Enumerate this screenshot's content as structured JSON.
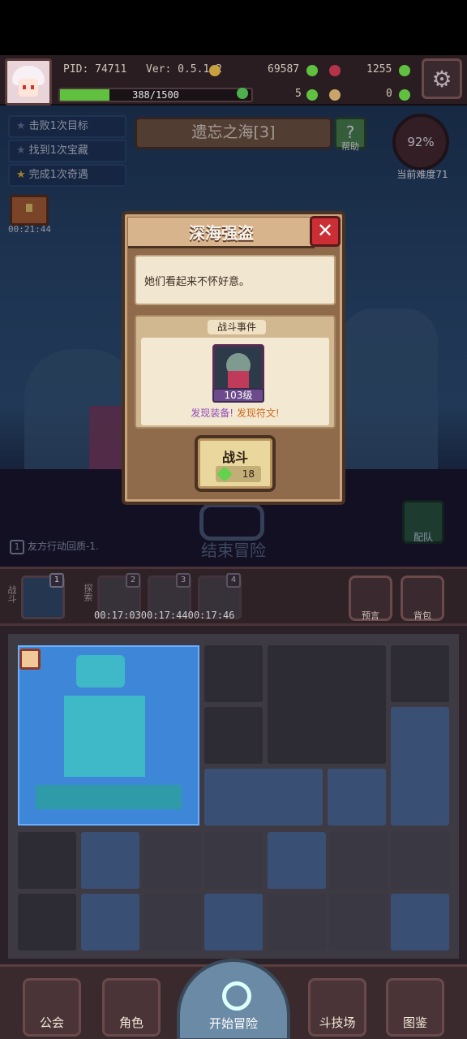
{
  "hud": {
    "pid": "PID: 74711",
    "version": "Ver: 0.5.1.2",
    "gold": "69587",
    "gems": "1255",
    "clover": "5",
    "potion": "0",
    "xp_text": "388/1500",
    "xp_fraction": 0.259
  },
  "location": {
    "name": "遗忘之海[3]",
    "help_label": "帮助",
    "difficulty_percent": "92%",
    "difficulty_label": "当前难度71"
  },
  "tasks": [
    {
      "label": "击败1次目标",
      "done": false
    },
    {
      "label": "找到1次宝藏",
      "done": false
    },
    {
      "label": "完成1次奇遇",
      "done": true
    }
  ],
  "chest_timer": "00:21:44",
  "modal": {
    "title": "深海强盗",
    "close_icon": "close-icon",
    "description": "她们看起来不怀好意。",
    "event_title": "战斗事件",
    "enemy_level": "103级",
    "find_equipment": "发现装备!",
    "find_rune": "发现符文!",
    "fight_label": "战斗",
    "fight_cost": "18"
  },
  "scene": {
    "end_adventure": "结束冒险",
    "team_label": "配队",
    "regen_num": "1",
    "regen_text": "友方行动回质-1."
  },
  "actionbar": {
    "battle_label": "战斗",
    "explore_label": "探索",
    "slot_numbers": [
      "1",
      "2",
      "3",
      "4"
    ],
    "times": "00:17:0300:17:4400:17:46",
    "prophecy_label": "预言",
    "bag_label": "背包"
  },
  "nav": {
    "guild": "公会",
    "character": "角色",
    "start": "开始冒险",
    "arena": "斗技场",
    "codex": "图鉴"
  },
  "colors": {
    "xp_fill": "#5fc13f",
    "close_red": "#cc2e35",
    "find_purple": "#8f4db5",
    "find_orange": "#c96a1c"
  }
}
